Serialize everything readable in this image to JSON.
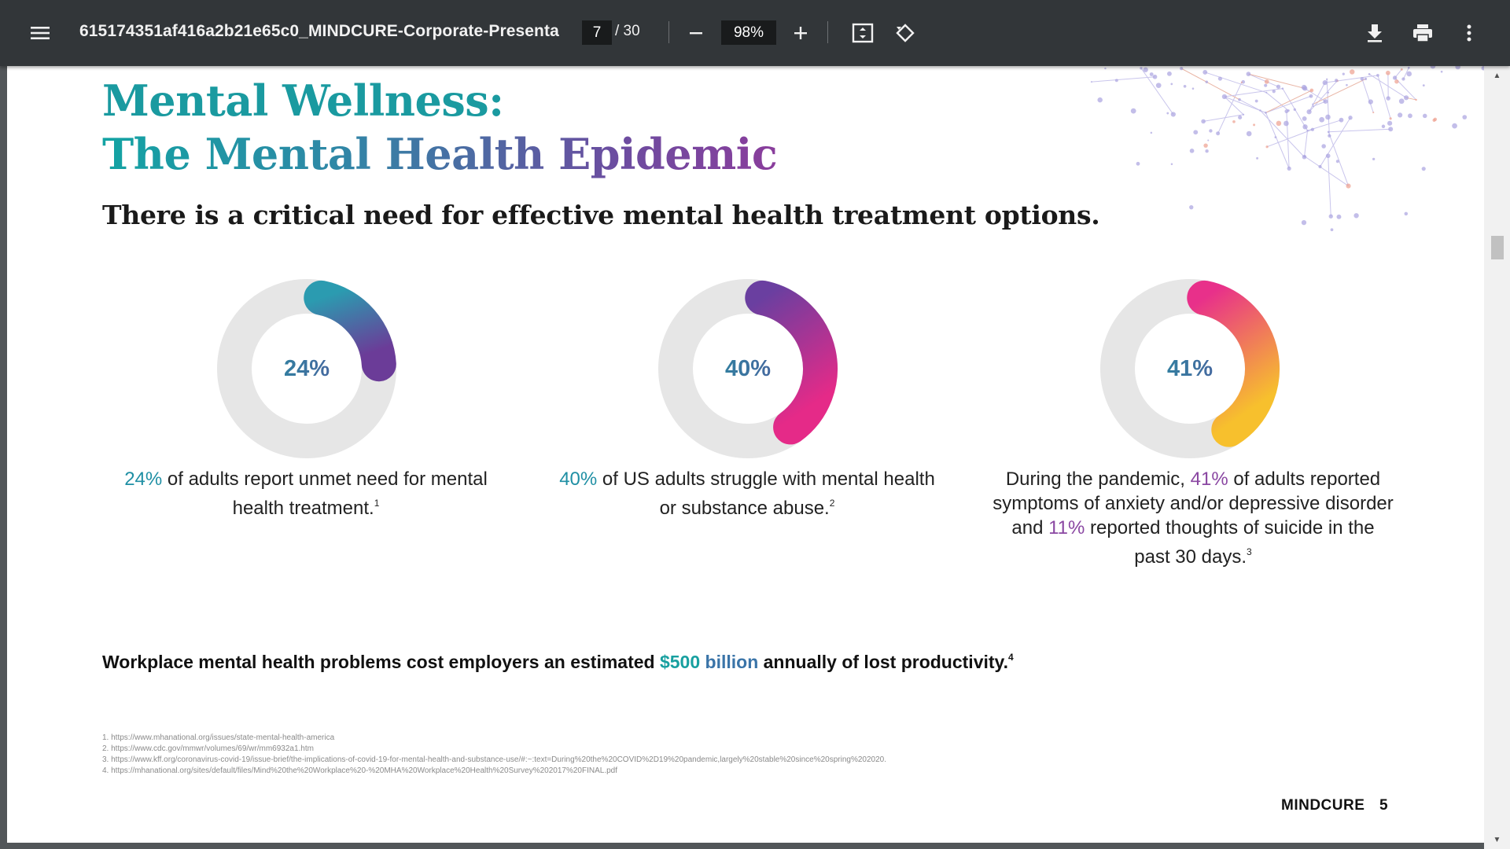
{
  "toolbar": {
    "title": "615174351af416a2b21e65c0_MINDCURE-Corporate-Presentat...",
    "page_current": "7",
    "page_total": "/ 30",
    "zoom": "98%",
    "icons": [
      "menu-icon",
      "minus-icon",
      "plus-icon",
      "fit-page-icon",
      "rotate-icon",
      "download-icon",
      "print-icon",
      "more-vert-icon"
    ]
  },
  "slide": {
    "title_line1": "Mental Wellness:",
    "title_line2": "The Mental Health Epidemic",
    "subtitle": "There is a critical need for effective mental health treatment options.",
    "stats": [
      {
        "percent": "24%",
        "fraction": 0.24,
        "gradient": [
          "#2b9bb0",
          "#6b3c98"
        ],
        "highlight": "24%",
        "text_a": " of adults report unmet need for mental health treatment.",
        "sup": "1"
      },
      {
        "percent": "40%",
        "fraction": 0.4,
        "gradient": [
          "#6a3fa0",
          "#e52a88"
        ],
        "highlight": "40%",
        "text_a": " of US adults struggle with mental health or substance abuse.",
        "sup": "2"
      },
      {
        "percent": "41%",
        "fraction": 0.41,
        "gradient": [
          "#e8308a",
          "#f7c02d"
        ],
        "text_pre": "During the pandemic, ",
        "highlight": "41%",
        "text_mid": " of adults reported symptoms of anxiety and/or depressive disorder and ",
        "highlight2": "11%",
        "text_post": " reported thoughts of suicide in the past 30 days.",
        "sup": "3"
      }
    ],
    "bottom": {
      "text_a": "Workplace mental health problems cost employers an estimated ",
      "money": "$500",
      "billion": " billion",
      "text_b": " annually of lost productivity.",
      "sup": "4"
    },
    "footnotes": [
      "1. https://www.mhanational.org/issues/state-mental-health-america",
      "2. https://www.cdc.gov/mmwr/volumes/69/wr/mm6932a1.htm",
      "3. https://www.kff.org/coronavirus-covid-19/issue-brief/the-implications-of-covid-19-for-mental-health-and-substance-use/#:~:text=During%20the%20COVID%2D19%20pandemic,largely%20stable%20since%20spring%202020.",
      "4. https://mhanational.org/sites/default/files/Mind%20the%20Workplace%20-%20MHA%20Workplace%20Health%20Survey%202017%20FINAL.pdf"
    ],
    "brand": "MINDCURE",
    "page_number": "5",
    "colors": {
      "teal": "#1a9aa0",
      "purple": "#8a47a2",
      "donut_track": "#e6e6e6"
    }
  }
}
